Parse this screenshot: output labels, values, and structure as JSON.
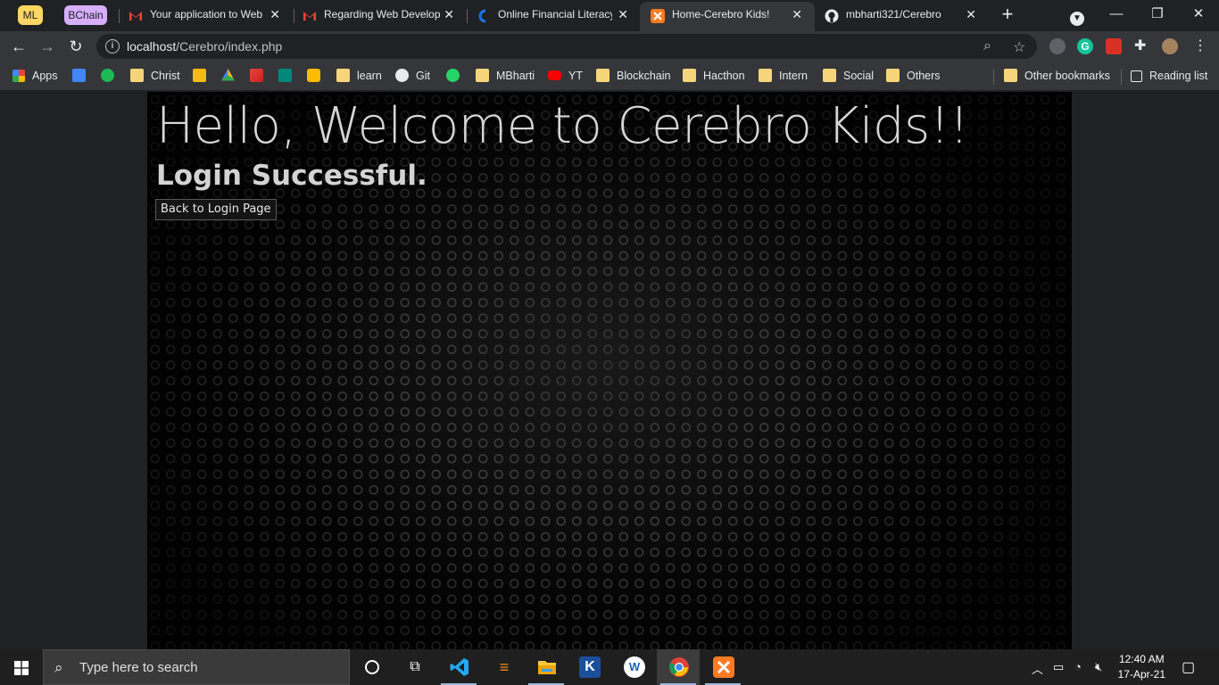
{
  "browser": {
    "tab_groups": [
      {
        "label": "ML",
        "color": "#fdd663"
      },
      {
        "label": "BChain",
        "color": "#d7aefb"
      }
    ],
    "tabs": [
      {
        "title": "Your application to Web",
        "icon": "gmail-icon"
      },
      {
        "title": "Regarding Web Develop",
        "icon": "gmail-icon"
      },
      {
        "title": "Online Financial Literacy",
        "icon": "site-icon"
      },
      {
        "title": "Home-Cerebro Kids!",
        "icon": "xampp-icon",
        "active": true
      },
      {
        "title": "mbharti321/Cerebro",
        "icon": "github-icon"
      }
    ],
    "url_host": "localhost",
    "url_path": "/Cerebro/index.php",
    "bookmarks": [
      "Apps",
      "Christ",
      "learn",
      "Git",
      "MBharti",
      "YT",
      "Blockchain",
      "Hacthon",
      "Intern",
      "Social",
      "Others"
    ],
    "other_bookmarks": "Other bookmarks",
    "reading_list": "Reading list"
  },
  "page": {
    "heading": "Hello, Welcome to Cerebro Kids!!",
    "status": "Login Successful.",
    "back_button": "Back to Login Page"
  },
  "taskbar": {
    "search_placeholder": "Type here to search",
    "time": "12:40 AM",
    "date": "17-Apr-21"
  }
}
